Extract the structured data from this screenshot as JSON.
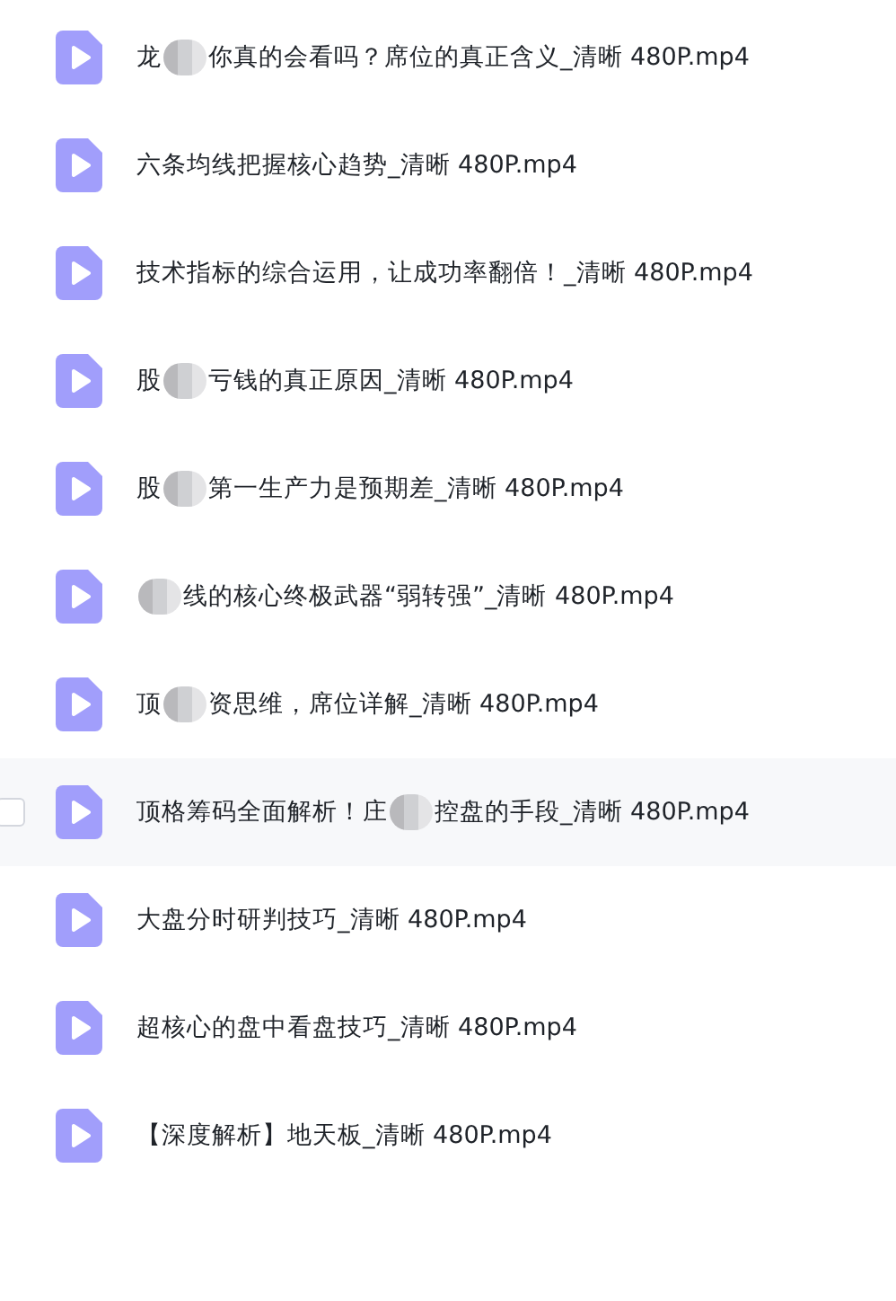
{
  "files": [
    {
      "parts": [
        "龙",
        "你真的会看吗？席位的真正含义_清晰 480P.mp4"
      ],
      "highlighted": false
    },
    {
      "parts": [
        "六条均线把握核心趋势_清晰 480P.mp4"
      ],
      "highlighted": false
    },
    {
      "parts": [
        "技术指标的综合运用，让成功率翻倍！_清晰 480P.mp4"
      ],
      "highlighted": false
    },
    {
      "parts": [
        "股",
        "亏钱的真正原因_清晰 480P.mp4"
      ],
      "highlighted": false
    },
    {
      "parts": [
        "股",
        "第一生产力是预期差_清晰 480P.mp4"
      ],
      "highlighted": false
    },
    {
      "lead_blur": true,
      "parts": [
        "线的核心终极武器“弱转强”_清晰 480P.mp4"
      ],
      "highlighted": false
    },
    {
      "parts": [
        "顶",
        "资思维，席位详解_清晰 480P.mp4"
      ],
      "highlighted": false
    },
    {
      "parts": [
        "顶格筹码全面解析！庄",
        "控盘的手段_清晰 480P.mp4"
      ],
      "highlighted": true
    },
    {
      "parts": [
        "大盘分时研判技巧_清晰 480P.mp4"
      ],
      "highlighted": false
    },
    {
      "parts": [
        "超核心的盘中看盘技巧_清晰 480P.mp4"
      ],
      "highlighted": false
    },
    {
      "parts": [
        "【深度解析】地天板_清晰 480P.mp4"
      ],
      "highlighted": false
    }
  ]
}
